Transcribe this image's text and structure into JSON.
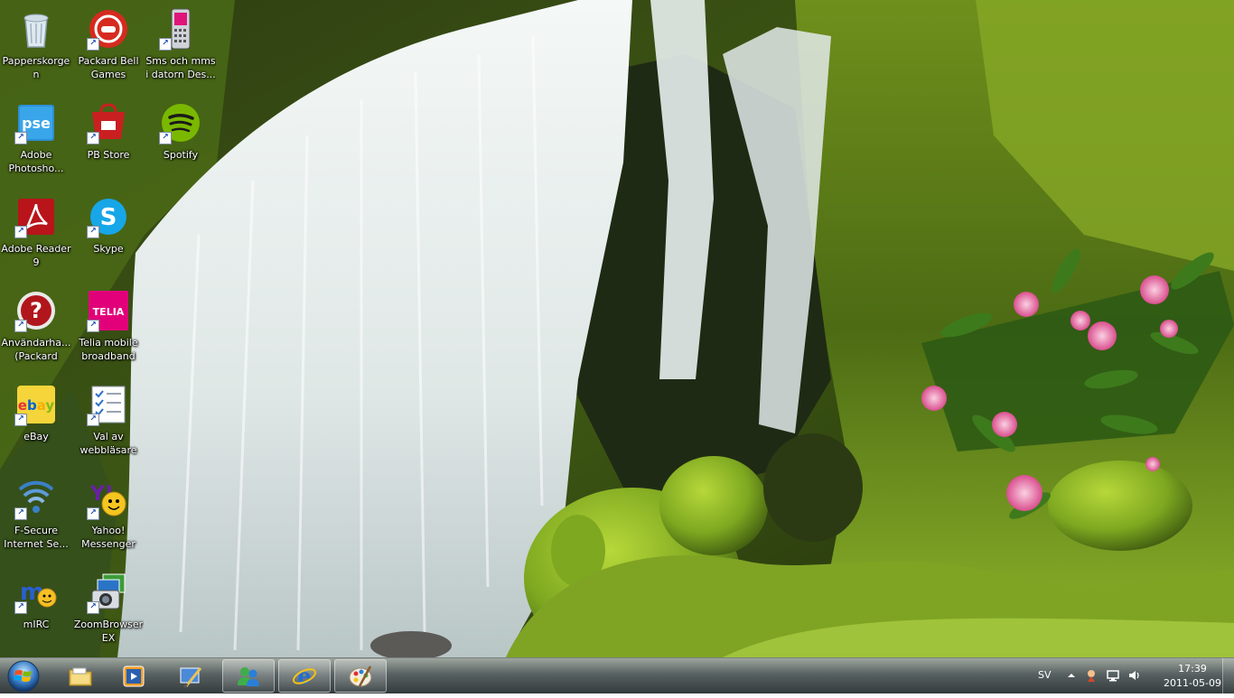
{
  "desktop": {
    "icons": [
      {
        "label": "Papperskorgen",
        "icon": "recycle-bin-icon",
        "shortcut": false
      },
      {
        "label": "Packard Bell Games",
        "icon": "packard-bell-games-icon",
        "shortcut": true
      },
      {
        "label": "Sms och mms i datorn Des...",
        "icon": "phone-icon",
        "shortcut": true
      },
      {
        "label": "Adobe Photosho...",
        "icon": "photoshop-elements-icon",
        "shortcut": true
      },
      {
        "label": "PB Store",
        "icon": "pb-store-icon",
        "shortcut": true
      },
      {
        "label": "Spotify",
        "icon": "spotify-icon",
        "shortcut": true
      },
      {
        "label": "Adobe Reader 9",
        "icon": "adobe-reader-icon",
        "shortcut": true
      },
      {
        "label": "Skype",
        "icon": "skype-icon",
        "shortcut": true
      },
      {
        "label": "Användarha... (Packard Bel...",
        "icon": "help-icon",
        "shortcut": true
      },
      {
        "label": "Telia mobile broadband",
        "icon": "telia-icon",
        "shortcut": true
      },
      {
        "label": "eBay",
        "icon": "ebay-icon",
        "shortcut": true
      },
      {
        "label": "Val av webbläsare",
        "icon": "browser-choice-icon",
        "shortcut": true
      },
      {
        "label": "F-Secure Internet Se...",
        "icon": "f-secure-icon",
        "shortcut": true
      },
      {
        "label": "Yahoo! Messenger",
        "icon": "yahoo-messenger-icon",
        "shortcut": true
      },
      {
        "label": "mIRC",
        "icon": "mirc-icon",
        "shortcut": true
      },
      {
        "label": "ZoomBrowser EX",
        "icon": "zoombrowser-icon",
        "shortcut": true
      }
    ]
  },
  "taskbar": {
    "start_icon": "windows-start-icon",
    "buttons": [
      {
        "icon": "file-explorer-icon",
        "running": false
      },
      {
        "icon": "media-player-icon",
        "running": false
      },
      {
        "icon": "paint-brush-icon",
        "running": false
      },
      {
        "icon": "messenger-icon",
        "running": true
      },
      {
        "icon": "internet-explorer-icon",
        "running": true
      },
      {
        "icon": "paint-icon",
        "running": true
      }
    ],
    "tray": {
      "language": "SV",
      "time": "17:39",
      "date": "2011-05-09"
    }
  },
  "colors": {
    "taskbar": "#3a4446",
    "label_text": "#ffffff"
  }
}
